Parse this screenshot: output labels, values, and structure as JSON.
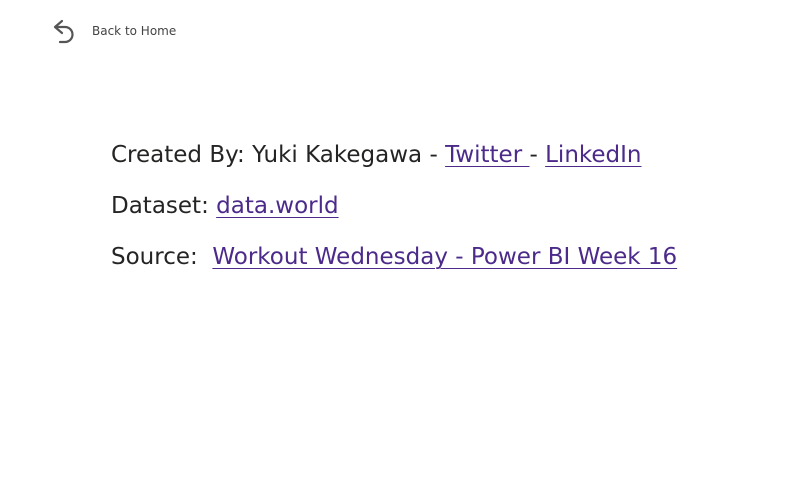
{
  "back_nav": {
    "label": "Back to Home",
    "icon": "undo-arrow-icon"
  },
  "credits": {
    "created_by_prefix": "Created By: ",
    "author": "Yuki Kakegawa",
    "separator": " - ",
    "twitter_label": "Twitter ",
    "linkedin_label": "LinkedIn",
    "dataset_prefix": "Dataset: ",
    "dataset_label": "data.world",
    "source_prefix": "Source:  ",
    "source_label": "Workout Wednesday - Power BI Week 16"
  },
  "colors": {
    "link": "#4b2a8a",
    "text": "#252423",
    "background": "#ffffff"
  }
}
